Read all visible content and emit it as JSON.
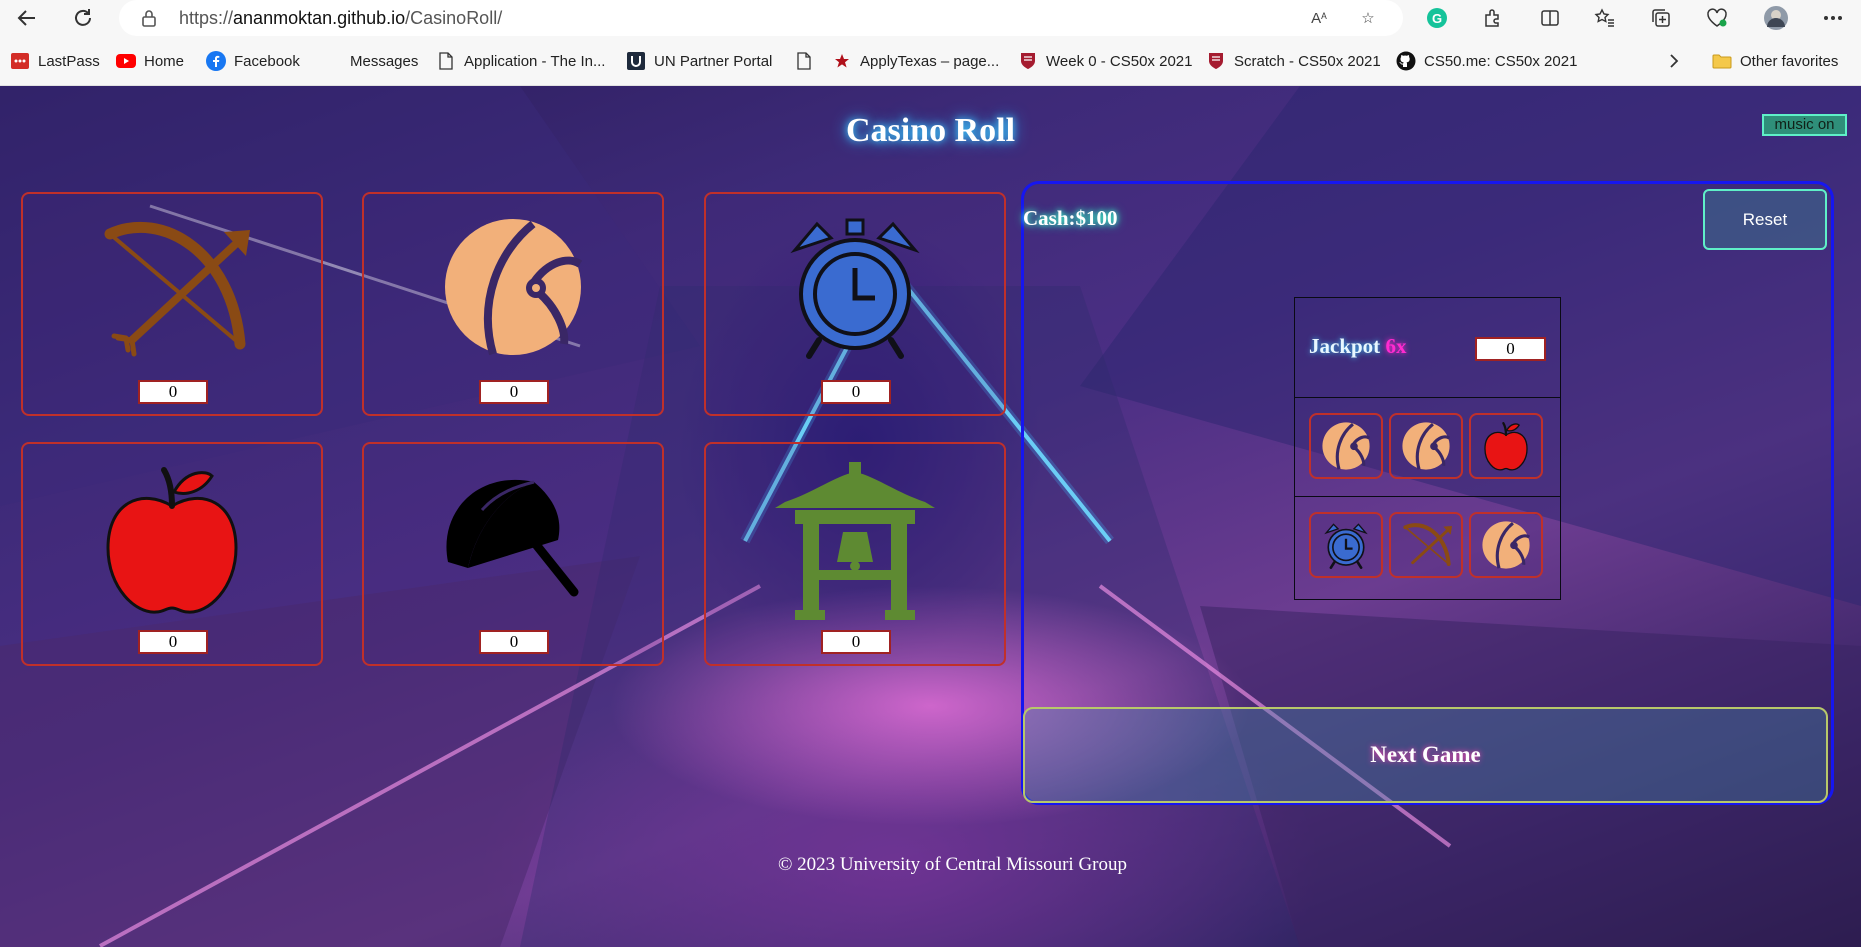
{
  "browser": {
    "url_prefix": "https://",
    "url_host": "ananmoktan.github.io",
    "url_path": "/CasinoRoll/"
  },
  "bookmarks": [
    {
      "label": "LastPass",
      "icon": "lastpass-icon"
    },
    {
      "label": "Home",
      "icon": "youtube-icon"
    },
    {
      "label": "Facebook",
      "icon": "facebook-icon"
    },
    {
      "label": "Messages",
      "icon": "messages-icon"
    },
    {
      "label": "Application - The In...",
      "icon": "page-icon"
    },
    {
      "label": "UN Partner Portal",
      "icon": "un-icon"
    },
    {
      "label": "",
      "icon": "page-icon"
    },
    {
      "label": "ApplyTexas – page...",
      "icon": "star-icon"
    },
    {
      "label": "Week 0 - CS50x 2021",
      "icon": "harvard-icon"
    },
    {
      "label": "Scratch - CS50x 2021",
      "icon": "harvard-icon"
    },
    {
      "label": "CS50.me: CS50x 2021",
      "icon": "github-icon"
    }
  ],
  "bookmarks_other": "Other favorites",
  "game": {
    "title": "Casino Roll",
    "music_button": "music on",
    "cash_label": "Cash:$100",
    "reset_label": "Reset",
    "tiles": [
      {
        "icon": "bow-arrow-icon",
        "count": "0",
        "color": "#8a4a14"
      },
      {
        "icon": "beach-ball-icon",
        "count": "0",
        "color": "#f2b07a"
      },
      {
        "icon": "alarm-clock-icon",
        "count": "0",
        "color": "#3a6bd0"
      },
      {
        "icon": "apple-icon",
        "count": "0",
        "color": "#e81414"
      },
      {
        "icon": "umbrella-icon",
        "count": "0",
        "color": "#000000"
      },
      {
        "icon": "pagoda-bell-icon",
        "count": "0",
        "color": "#5e8a32"
      }
    ],
    "jackpot": {
      "label": "Jackpot",
      "multiplier": "6x",
      "value": "0",
      "row1": [
        "beach-ball-icon",
        "beach-ball-icon",
        "apple-icon"
      ],
      "row2": [
        "alarm-clock-icon",
        "bow-arrow-icon",
        "beach-ball-icon"
      ]
    },
    "next_game_label": "Next Game",
    "footer": "© 2023 University of Central Missouri Group"
  }
}
